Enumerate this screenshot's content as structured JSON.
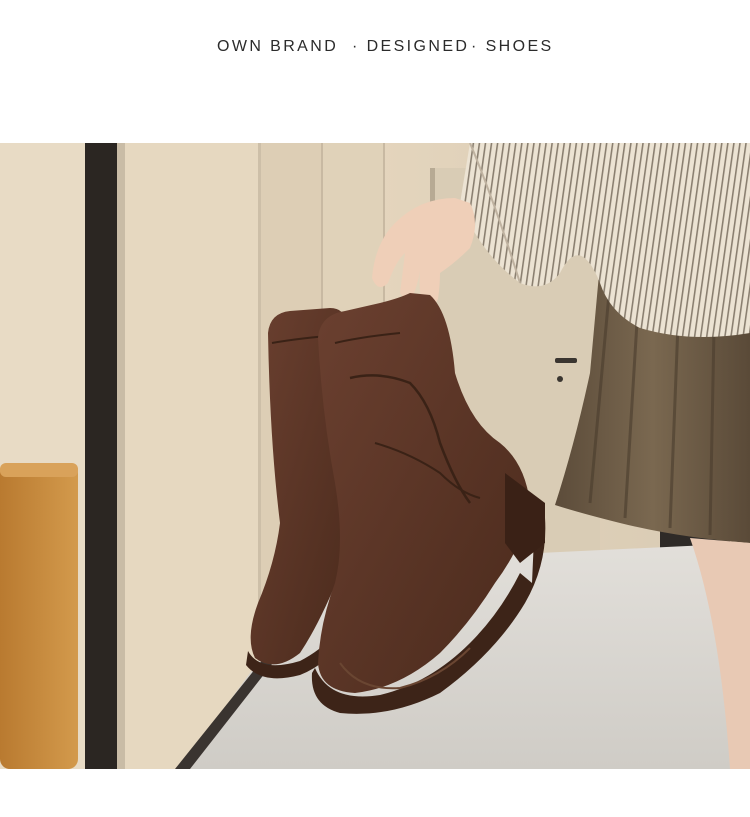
{
  "header": {
    "tagline": {
      "part1": "OWN BRAND",
      "part2": "· DESIGNED",
      "part3": "· SHOES"
    }
  },
  "photo": {
    "subject": "hand holding a pair of brown suede slouch ankle boots",
    "colors": {
      "wall": "#e9dcc6",
      "door_frame": "#2b2622",
      "suede": "#5a3524",
      "sole": "#4a2b1e",
      "skirt": "#6b5a45",
      "shirt_stripe": "#e6dccb",
      "sofa": "#c98a3a",
      "floor": "#d7d4cf"
    }
  }
}
